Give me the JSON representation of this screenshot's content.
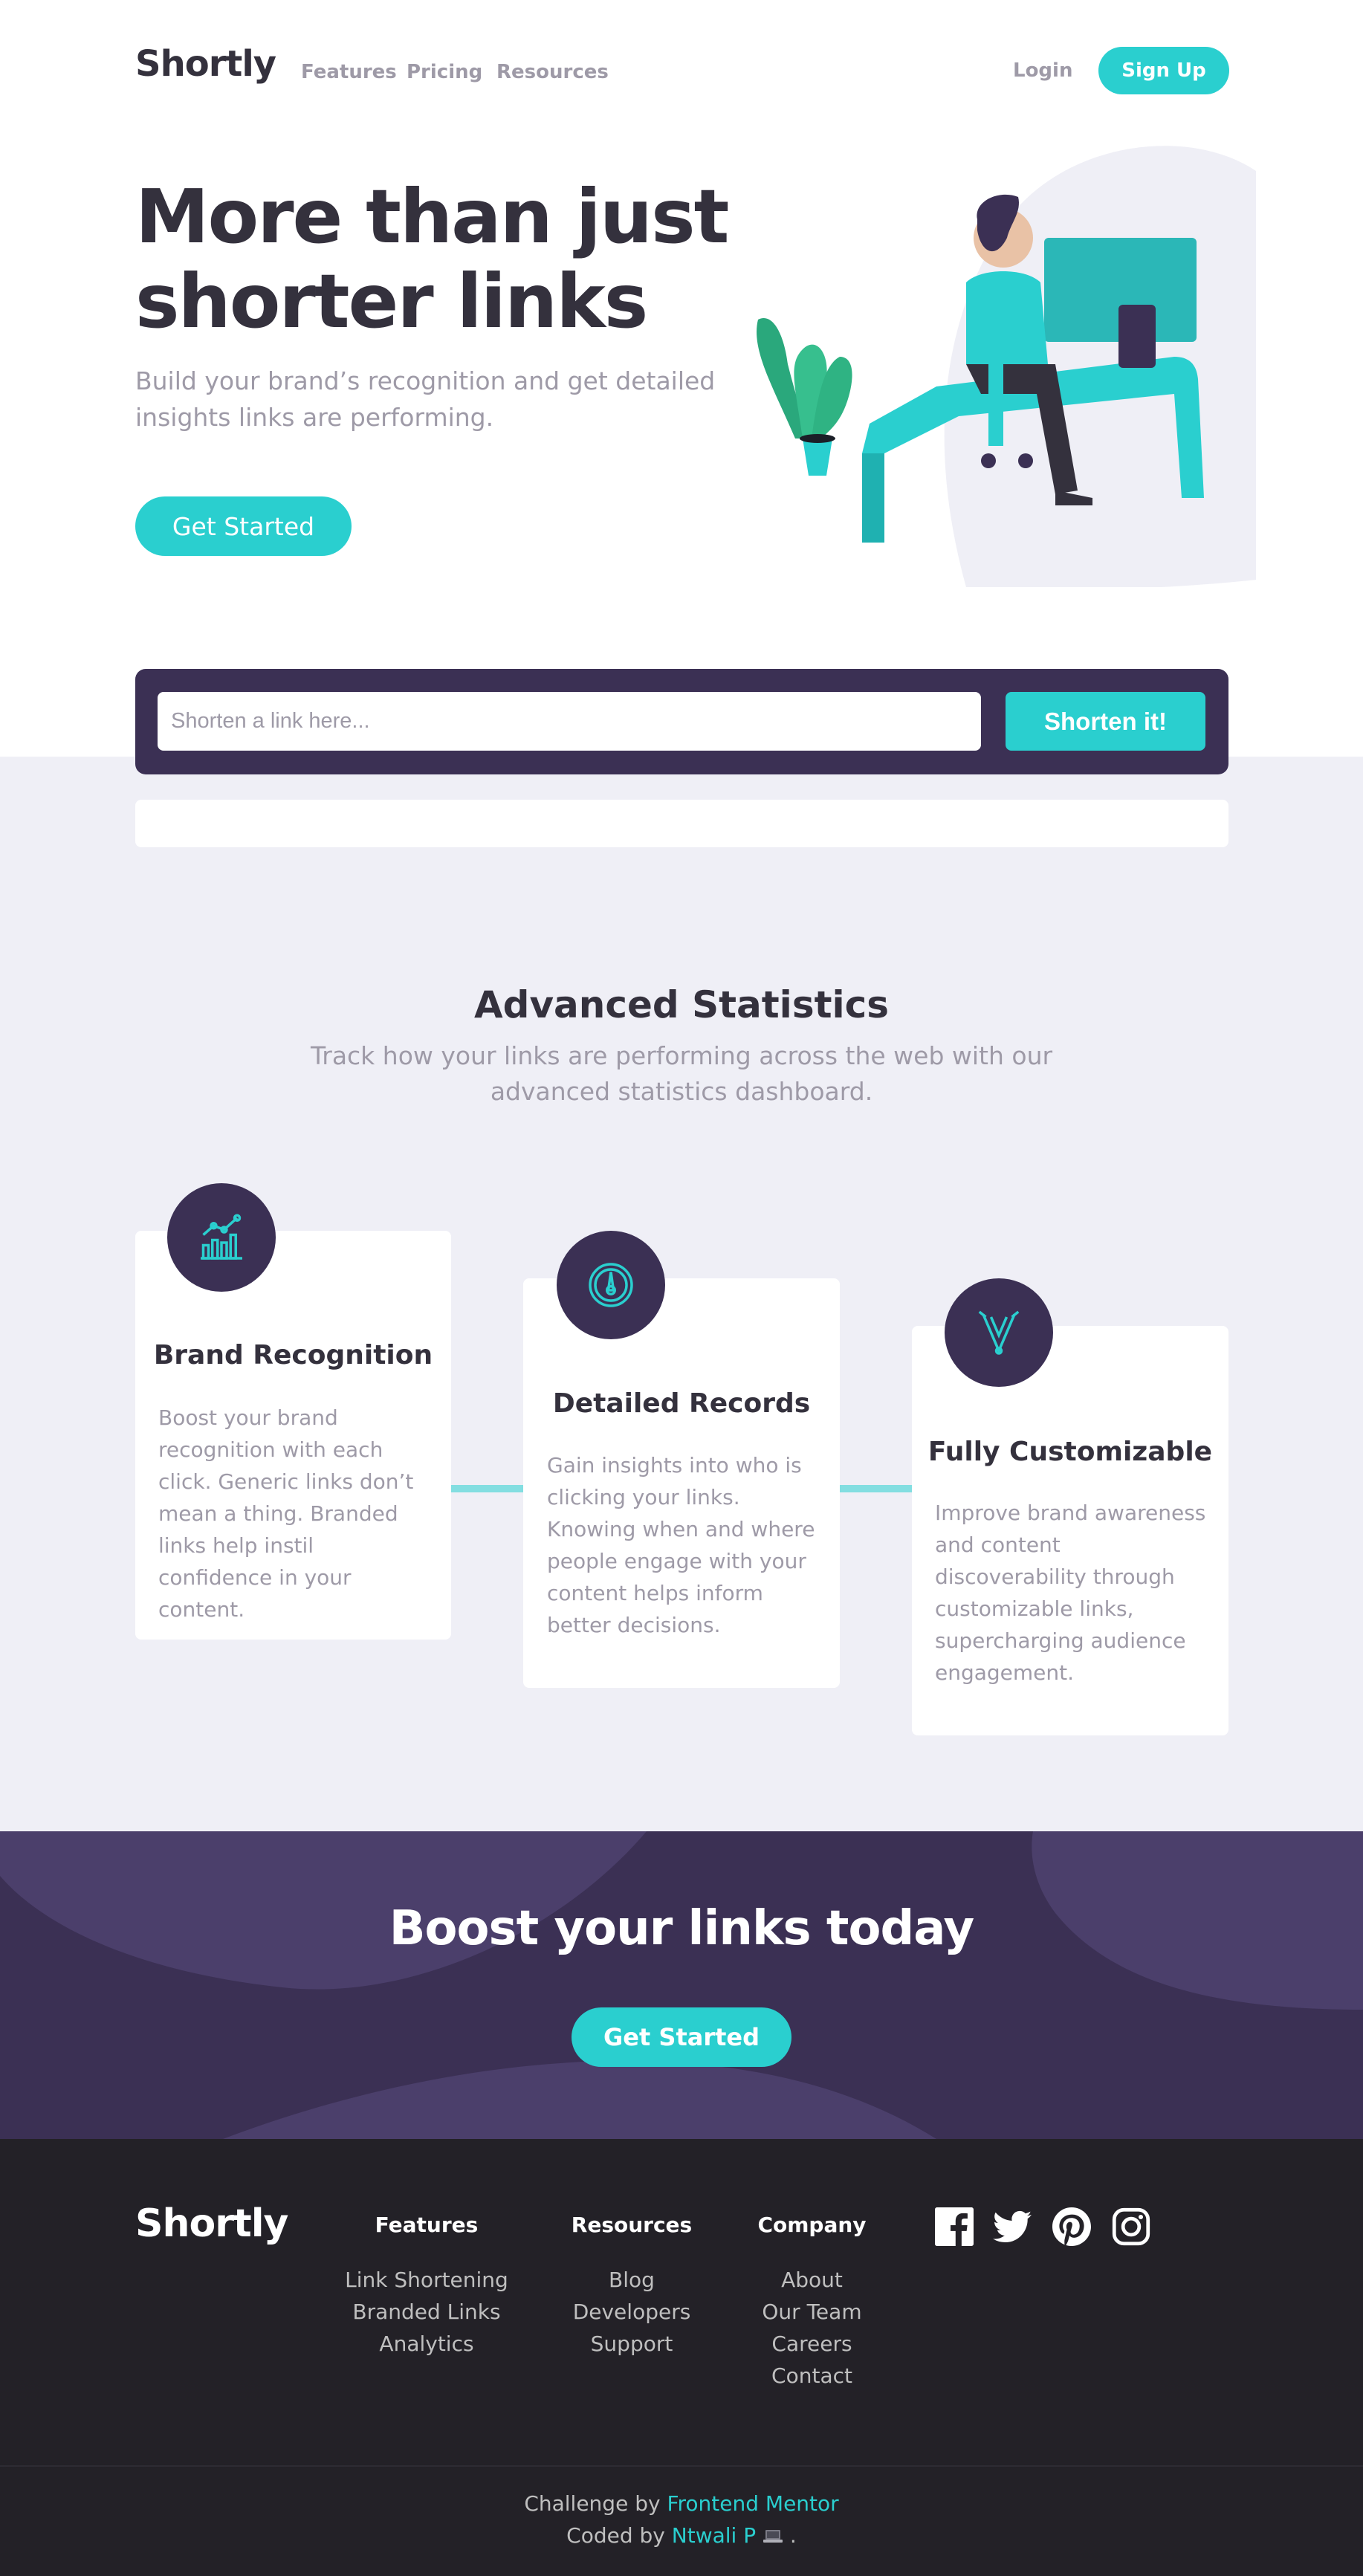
{
  "header": {
    "logo": "Shortly",
    "nav": [
      "Features",
      "Pricing",
      "Resources"
    ],
    "login": "Login",
    "signup": "Sign Up"
  },
  "hero": {
    "title": "More than just shorter links",
    "subtitle": "Build your brand’s recognition and get detailed insights links are performing.",
    "cta": "Get Started"
  },
  "shorten": {
    "placeholder": "Shorten a link here...",
    "button": "Shorten it!"
  },
  "stats": {
    "title": "Advanced Statistics",
    "subtitle": "Track how your links are performing across the web with our advanced statistics dashboard.",
    "cards": [
      {
        "icon": "brand-recognition-icon",
        "title": "Brand Recognition",
        "text": "Boost your brand recognition with each click. Generic links don’t mean a thing. Branded links help instil confidence in your content."
      },
      {
        "icon": "detailed-records-icon",
        "title": "Detailed Records",
        "text": "Gain insights into who is clicking your links. Knowing when and where people engage with your content helps inform better decisions."
      },
      {
        "icon": "fully-customizable-icon",
        "title": "Fully Customizable",
        "text": "Improve brand awareness and content discoverability through customizable links, supercharging audience engagement."
      }
    ]
  },
  "boost": {
    "title": "Boost your links today",
    "cta": "Get Started"
  },
  "footer": {
    "logo": "Shortly",
    "columns": [
      {
        "heading": "Features",
        "links": [
          "Link Shortening",
          "Branded Links",
          "Analytics"
        ]
      },
      {
        "heading": "Resources",
        "links": [
          "Blog",
          "Developers",
          "Support"
        ]
      },
      {
        "heading": "Company",
        "links": [
          "About",
          "Our Team",
          "Careers",
          "Contact"
        ]
      }
    ],
    "social": [
      "facebook-icon",
      "twitter-icon",
      "pinterest-icon",
      "instagram-icon"
    ],
    "attribution": {
      "challenge_prefix": "Challenge by",
      "challenge_link": "Frontend Mentor",
      "coded_prefix": "Coded by",
      "coded_link": "Ntwali P",
      "coded_suffix": "."
    }
  },
  "colors": {
    "cyan": "#2acfcf",
    "dark_violet": "#3b3054",
    "very_dark_violet": "#232127",
    "grayish_violet": "#9e9aa7",
    "light_background": "#efeff6"
  }
}
